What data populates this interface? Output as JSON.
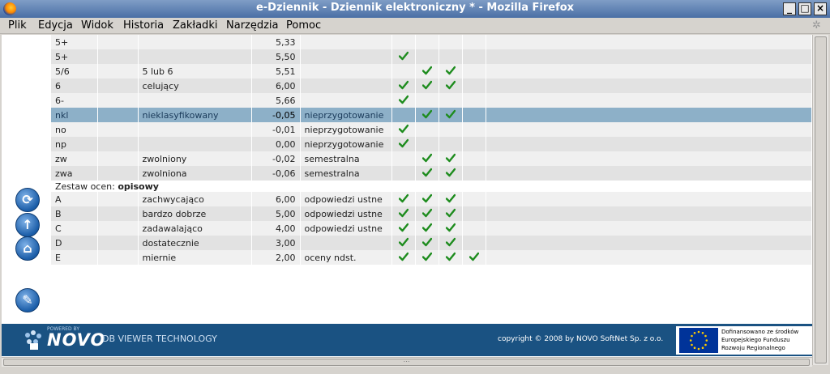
{
  "window": {
    "title": "e-Dziennik - Dziennik elektroniczny * - Mozilla Firefox"
  },
  "menu": [
    "Plik",
    "Edycja",
    "Widok",
    "Historia",
    "Zakładki",
    "Narzędzia",
    "Pomoc"
  ],
  "rows_top": [
    {
      "code": "5+",
      "name": "",
      "value": "5,33",
      "desc": "",
      "checks": [
        false,
        false,
        false,
        false
      ]
    },
    {
      "code": "5+",
      "name": "",
      "value": "5,50",
      "desc": "",
      "checks": [
        true,
        false,
        false,
        false
      ]
    },
    {
      "code": "5/6",
      "name": "5 lub 6",
      "value": "5,51",
      "desc": "",
      "checks": [
        false,
        true,
        true,
        false
      ]
    },
    {
      "code": "6",
      "name": "celujący",
      "value": "6,00",
      "desc": "",
      "checks": [
        true,
        true,
        true,
        false
      ]
    },
    {
      "code": "6-",
      "name": "",
      "value": "5,66",
      "desc": "",
      "checks": [
        true,
        false,
        false,
        false
      ]
    },
    {
      "code": "nkl",
      "name": "nieklasyfikowany",
      "value": "-0,05",
      "desc": "nieprzygotowanie",
      "checks": [
        false,
        true,
        true,
        false
      ],
      "selected": true
    },
    {
      "code": "no",
      "name": "",
      "value": "-0,01",
      "desc": "nieprzygotowanie",
      "checks": [
        true,
        false,
        false,
        false
      ]
    },
    {
      "code": "np",
      "name": "",
      "value": "0,00",
      "desc": "nieprzygotowanie",
      "checks": [
        true,
        false,
        false,
        false
      ]
    },
    {
      "code": "zw",
      "name": "zwolniony",
      "value": "-0,02",
      "desc": "semestralna",
      "checks": [
        false,
        true,
        true,
        false
      ]
    },
    {
      "code": "zwa",
      "name": "zwolniona",
      "value": "-0,06",
      "desc": "semestralna",
      "checks": [
        false,
        true,
        true,
        false
      ]
    }
  ],
  "section": {
    "label": "Zestaw ocen:",
    "name": "opisowy"
  },
  "rows_bottom": [
    {
      "code": "A",
      "name": "zachwycająco",
      "value": "6,00",
      "desc": "odpowiedzi ustne",
      "checks": [
        true,
        true,
        true,
        false
      ]
    },
    {
      "code": "B",
      "name": "bardzo dobrze",
      "value": "5,00",
      "desc": "odpowiedzi ustne",
      "checks": [
        true,
        true,
        true,
        false
      ]
    },
    {
      "code": "C",
      "name": "zadawalająco",
      "value": "4,00",
      "desc": "odpowiedzi ustne",
      "checks": [
        true,
        true,
        true,
        false
      ]
    },
    {
      "code": "D",
      "name": "dostatecznie",
      "value": "3,00",
      "desc": "",
      "checks": [
        true,
        true,
        true,
        false
      ]
    },
    {
      "code": "E",
      "name": "miernie",
      "value": "2,00",
      "desc": "oceny ndst.",
      "checks": [
        true,
        true,
        true,
        true
      ]
    }
  ],
  "side_buttons": [
    "refresh-icon",
    "arrow-up-icon",
    "home-icon",
    "edit-icon"
  ],
  "footer": {
    "powered": "POWERED BY",
    "brand": "NOVO",
    "tech": "DB VIEWER TECHNOLOGY",
    "copyright": "copyright © 2008 by NOVO SoftNet Sp. z o.o.",
    "eu_text": "Dofinansowano ze środków Europejskiego Funduszu Rozwoju Regionalnego"
  },
  "colors": {
    "check": "#1e8c1e",
    "selected_row": "#8db0c8",
    "footer_bg": "#1a5282",
    "titlebar": "#4a6fa5"
  }
}
